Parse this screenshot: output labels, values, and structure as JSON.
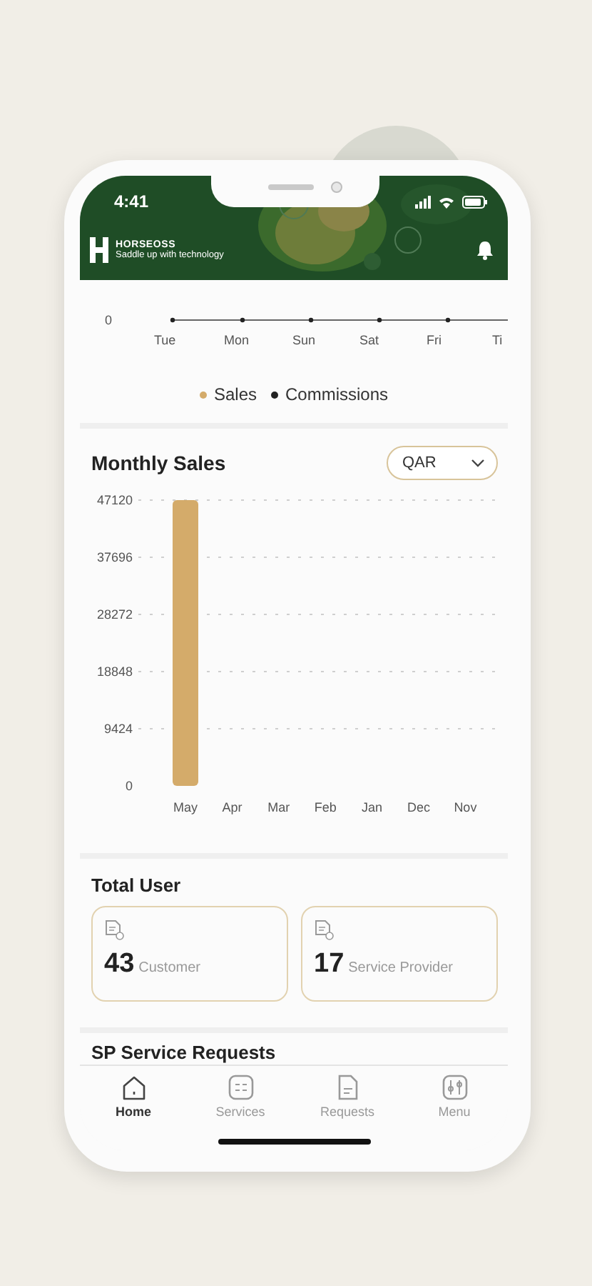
{
  "status_bar": {
    "time": "4:41"
  },
  "header": {
    "brand": "HORSEOSS",
    "tagline": "Saddle up with technology"
  },
  "weekly_chart": {
    "y_tick": "0",
    "days": [
      "Tue",
      "Mon",
      "Sun",
      "Sat",
      "Fri",
      "Ti"
    ],
    "legend": [
      {
        "label": "Sales",
        "color": "#d4ab6a"
      },
      {
        "label": "Commissions",
        "color": "#222222"
      }
    ]
  },
  "monthly_sales": {
    "title": "Monthly Sales",
    "currency": {
      "value": "QAR"
    },
    "chart_data": {
      "type": "bar",
      "categories": [
        "May",
        "Apr",
        "Mar",
        "Feb",
        "Jan",
        "Dec",
        "Nov"
      ],
      "values": [
        47120,
        0,
        0,
        0,
        0,
        0,
        0
      ],
      "ylim": [
        0,
        47120
      ],
      "grid": true,
      "yticks": [
        0,
        9424,
        18848,
        28272,
        37696,
        47120
      ]
    }
  },
  "total_user": {
    "title": "Total User",
    "stats": [
      {
        "count": "43",
        "label": "Customer"
      },
      {
        "count": "17",
        "label": "Service Provider"
      }
    ]
  },
  "sp_service_requests": {
    "title": "SP Service Requests"
  },
  "tabs": [
    {
      "label": "Home",
      "kind": "home",
      "selected": true
    },
    {
      "label": "Services",
      "kind": "services",
      "selected": false
    },
    {
      "label": "Requests",
      "kind": "requests",
      "selected": false
    },
    {
      "label": "Menu",
      "kind": "menu",
      "selected": false
    }
  ]
}
